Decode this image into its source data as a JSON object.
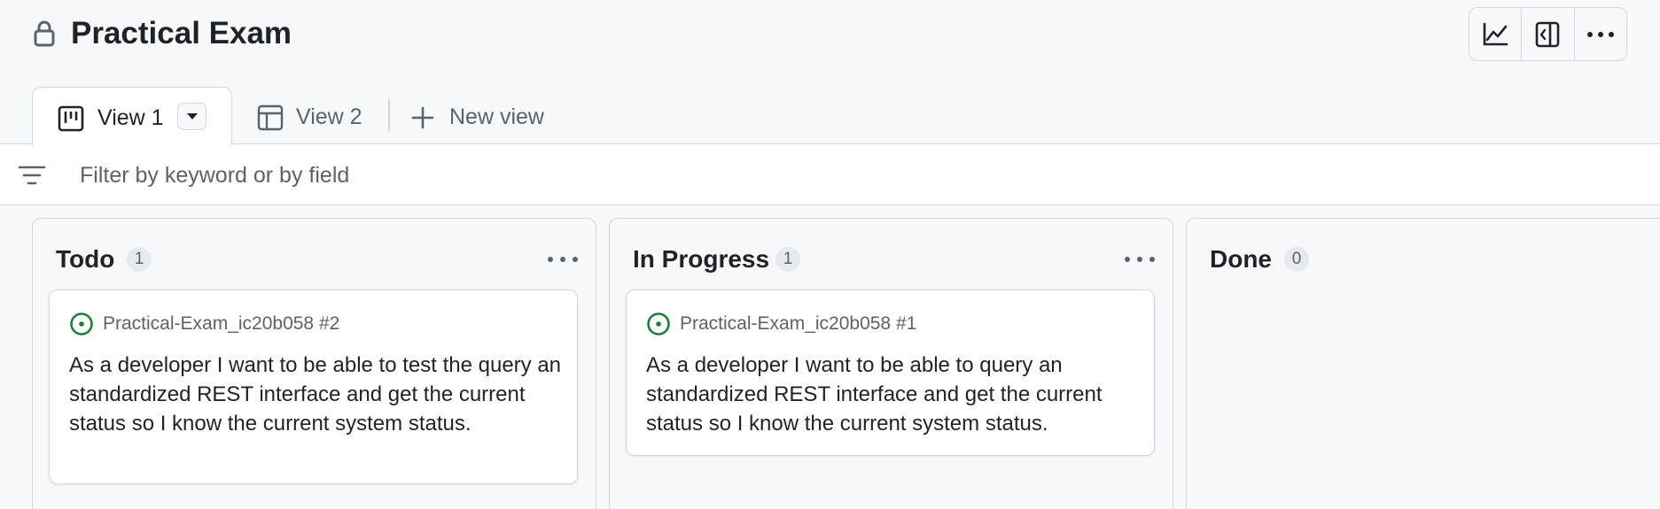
{
  "header": {
    "title": "Practical Exam",
    "icons": [
      "lock-icon",
      "insights-chart-icon",
      "sidepanel-icon",
      "kebab-menu-icon"
    ]
  },
  "tabs": [
    {
      "label": "View 1",
      "icon": "board-layout-icon",
      "active": true
    },
    {
      "label": "View 2",
      "icon": "table-layout-icon",
      "active": false
    }
  ],
  "new_view": {
    "label": "New view",
    "icon": "plus-icon"
  },
  "filter": {
    "placeholder": "Filter by keyword or by field",
    "value": ""
  },
  "columns": [
    {
      "title": "Todo",
      "count": "1",
      "cards": [
        {
          "ref": "Practical-Exam_ic20b058 #2",
          "status_icon": "open-issue-icon",
          "text": "As a developer I want to be able to test the query an standardized REST interface and get the current status so I know the current system status."
        }
      ]
    },
    {
      "title": "In Progress",
      "count": "1",
      "cards": [
        {
          "ref": "Practical-Exam_ic20b058 #1",
          "status_icon": "open-issue-icon",
          "text": "As a developer I want to be able to query an standardized REST interface and get the current status so I know the current system status."
        }
      ]
    },
    {
      "title": "Done",
      "count": "0",
      "cards": []
    }
  ],
  "colors": {
    "open_issue_green": "#1a7f37",
    "border": "#d0d7de",
    "muted_text": "#59636e",
    "background": "#f6f8fa"
  }
}
